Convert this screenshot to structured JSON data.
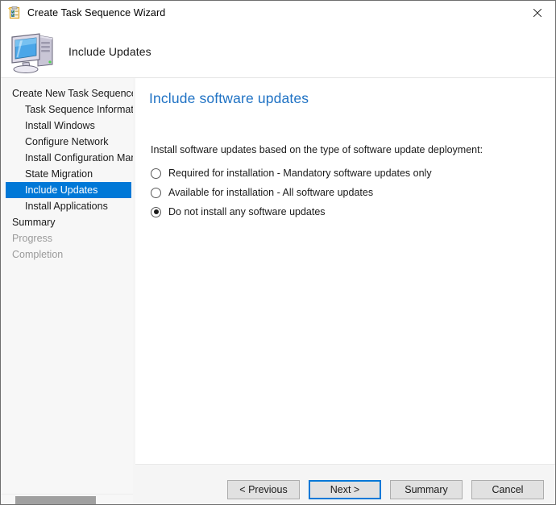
{
  "window": {
    "title": "Create Task Sequence Wizard",
    "title_icon": "task-sequence-clipboard-icon",
    "close_label": "×"
  },
  "header": {
    "icon": "computer-icon",
    "title": "Include Updates"
  },
  "sidebar": {
    "items": [
      {
        "label": "Create New Task Sequence",
        "indent": false,
        "state": "normal"
      },
      {
        "label": "Task Sequence Information",
        "indent": true,
        "state": "normal"
      },
      {
        "label": "Install Windows",
        "indent": true,
        "state": "normal"
      },
      {
        "label": "Configure Network",
        "indent": true,
        "state": "normal"
      },
      {
        "label": "Install Configuration Manager",
        "indent": true,
        "state": "normal"
      },
      {
        "label": "State Migration",
        "indent": true,
        "state": "normal"
      },
      {
        "label": "Include Updates",
        "indent": true,
        "state": "selected"
      },
      {
        "label": "Install Applications",
        "indent": true,
        "state": "normal"
      },
      {
        "label": "Summary",
        "indent": false,
        "state": "normal"
      },
      {
        "label": "Progress",
        "indent": false,
        "state": "disabled"
      },
      {
        "label": "Completion",
        "indent": false,
        "state": "disabled"
      }
    ],
    "scrollbar": "horizontal-scrollbar"
  },
  "content": {
    "title": "Include software updates",
    "description": "Install software updates based on the type of software update deployment:",
    "options": [
      {
        "label": "Required for installation - Mandatory software updates only",
        "checked": false
      },
      {
        "label": "Available for installation - All software updates",
        "checked": false
      },
      {
        "label": "Do not install any software updates",
        "checked": true
      }
    ]
  },
  "footer": {
    "buttons": [
      {
        "label": "< Previous",
        "default": false
      },
      {
        "label": "Next >",
        "default": true
      },
      {
        "label": "Summary",
        "default": false
      },
      {
        "label": "Cancel",
        "default": false
      }
    ]
  },
  "colors": {
    "accent": "#0078d7",
    "title_blue": "#1f72c4",
    "window_bg": "#f5f5f5",
    "panel_bg": "#ffffff"
  }
}
